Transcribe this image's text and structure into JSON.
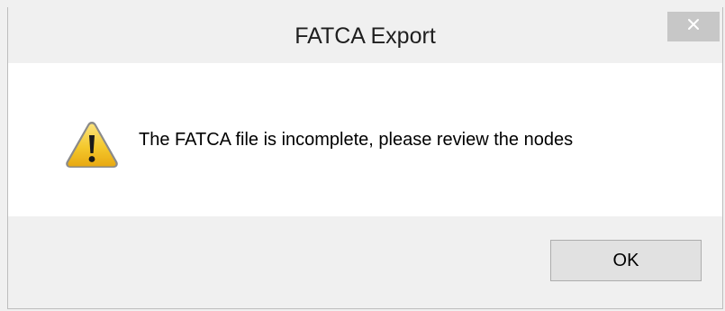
{
  "window": {
    "title": "FATCA Export",
    "close_icon": "close-icon"
  },
  "dialog": {
    "icon": "warning-icon",
    "message": "The FATCA file is incomplete, please review the nodes"
  },
  "buttons": {
    "ok_label": "OK"
  },
  "colors": {
    "titlebar_bg": "#f0f0f0",
    "close_bg": "#c7c7c7",
    "content_bg": "#ffffff",
    "warning_yellow": "#f4c82c"
  }
}
